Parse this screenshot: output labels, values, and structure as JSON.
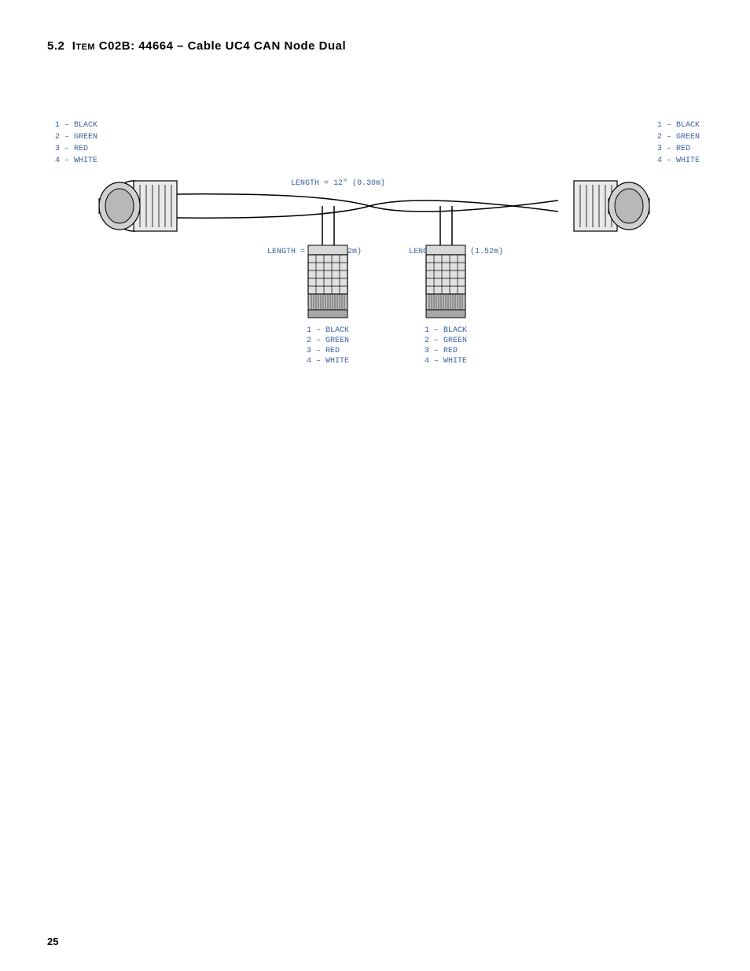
{
  "page": {
    "number": "25",
    "section": {
      "number": "5.2",
      "title": "Item C02B: 44664 – Cable UC4 CAN Node Dual"
    }
  },
  "diagram": {
    "length_top": "LENGTH = 12\" (0.30m)",
    "length_bottom_left": "LENGTH = 60\" (1.52m)",
    "length_bottom_right": "LENGTH = 60\" (1.52m)",
    "wire_labels": {
      "left_connector": [
        "1  -  BLACK",
        "2  -  GREEN",
        "3  -  RED",
        "4  -  WHITE"
      ],
      "right_connector": [
        "1  -  BLACK",
        "2  -  GREEN",
        "3  -  RED",
        "4  -  WHITE"
      ],
      "bottom_left_connector": [
        "1  -  BLACK",
        "2  -  GREEN",
        "3  -  RED",
        "4  -  WHITE"
      ],
      "bottom_right_connector": [
        "1  -  BLACK",
        "2  -  GREEN",
        "3  -  RED",
        "4  -  WHITE"
      ]
    }
  }
}
